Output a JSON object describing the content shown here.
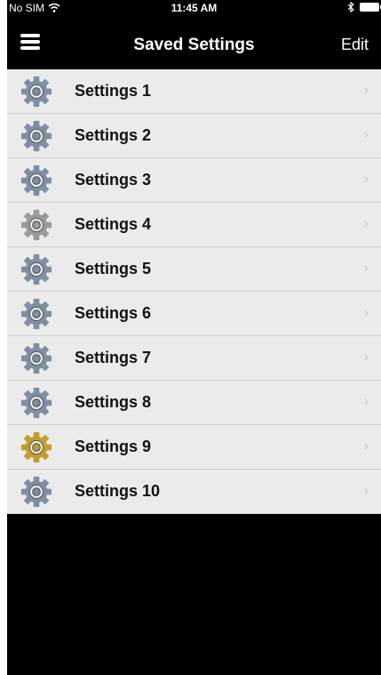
{
  "status": {
    "carrier": "No SIM",
    "time": "11:45 AM"
  },
  "nav": {
    "title": "Saved Settings",
    "edit_label": "Edit"
  },
  "settings": [
    {
      "label": "Settings 1",
      "icon": "gear-icon",
      "color": "#7f8fa3"
    },
    {
      "label": "Settings 2",
      "icon": "gear-icon",
      "color": "#7f8fa3"
    },
    {
      "label": "Settings 3",
      "icon": "gear-icon",
      "color": "#7f8fa3"
    },
    {
      "label": "Settings 4",
      "icon": "gear-icon",
      "color": "#9a9a9a"
    },
    {
      "label": "Settings 5",
      "icon": "gear-icon",
      "color": "#7f8fa3"
    },
    {
      "label": "Settings 6",
      "icon": "gear-icon",
      "color": "#7f8fa3"
    },
    {
      "label": "Settings 7",
      "icon": "gear-icon",
      "color": "#7f8fa3"
    },
    {
      "label": "Settings 8",
      "icon": "gear-icon",
      "color": "#7f8fa3"
    },
    {
      "label": "Settings 9",
      "icon": "gear-icon",
      "color": "#c59d2b"
    },
    {
      "label": "Settings 10",
      "icon": "gear-icon",
      "color": "#7f8fa3"
    }
  ],
  "chevron": "›"
}
